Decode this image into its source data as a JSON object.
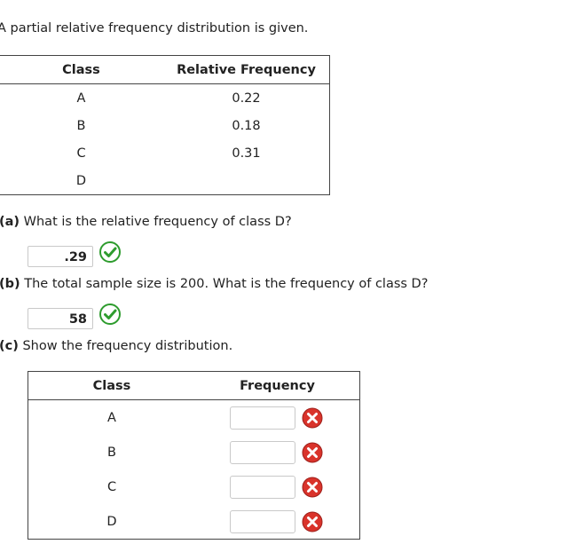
{
  "intro": "A partial relative frequency distribution is given.",
  "relative_table": {
    "headers": [
      "Class",
      "Relative Frequency"
    ],
    "rows": [
      {
        "class": "A",
        "rel": "0.22"
      },
      {
        "class": "B",
        "rel": "0.18"
      },
      {
        "class": "C",
        "rel": "0.31"
      },
      {
        "class": "D",
        "rel": ""
      }
    ]
  },
  "part_a": {
    "label": "(a)",
    "text": "What is the relative frequency of class D?",
    "answer": ".29",
    "status": "correct"
  },
  "part_b": {
    "label": "(b)",
    "text": "The total sample size is 200. What is the frequency of class D?",
    "answer": "58",
    "status": "correct"
  },
  "part_c": {
    "label": "(c)",
    "text": "Show the frequency distribution."
  },
  "frequency_table": {
    "headers": [
      "Class",
      "Frequency"
    ],
    "rows": [
      {
        "class": "A",
        "value": "",
        "status": "incorrect"
      },
      {
        "class": "B",
        "value": "",
        "status": "incorrect"
      },
      {
        "class": "C",
        "value": "",
        "status": "incorrect"
      },
      {
        "class": "D",
        "value": "",
        "status": "incorrect"
      }
    ]
  },
  "colors": {
    "correct": "#2e9c2e",
    "incorrect": "#d9332b"
  },
  "icons": {
    "correct": "check-circle-icon",
    "incorrect": "x-circle-icon"
  }
}
